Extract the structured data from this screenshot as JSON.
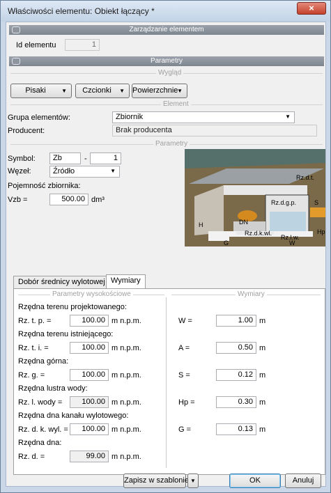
{
  "window": {
    "title": "Właściwości elementu: Obiekt łączący *",
    "close_label": "×"
  },
  "sections": {
    "management": "Zarządzanie elementem",
    "parameters": "Parametry"
  },
  "id": {
    "label": "Id elementu",
    "value": "1"
  },
  "appearance": {
    "group": "Wygląd",
    "pens": "Pisaki",
    "fonts": "Czcionki",
    "surfaces": "Powierzchnie"
  },
  "element": {
    "group": "Element",
    "group_label": "Grupa elementów:",
    "group_value": "Zbiornik",
    "producer_label": "Producent:",
    "producer_value": "Brak producenta"
  },
  "params": {
    "group": "Parametry",
    "symbol_label": "Symbol:",
    "symbol_value": "Zb",
    "symbol_sep": "-",
    "symbol_num": "1",
    "node_label": "Węzeł:",
    "node_value": "Źródło",
    "capacity_label": "Pojemność zbiornika:",
    "vzb_label": "Vzb =",
    "vzb_value": "500.00",
    "vzb_unit": "dm³"
  },
  "diagram": {
    "rzdt": "Rz.d.t.",
    "rzdgp": "Rz.d.g.p.",
    "dn": "DN",
    "rzdkwl": "Rz.d.k.wl.",
    "rzlw": "Rz.l.w.",
    "h": "H",
    "hp": "Hp",
    "g": "G",
    "w": "W",
    "s": "S"
  },
  "tabs": [
    {
      "label": "Dobór średnicy wylotowej"
    },
    {
      "label": "Wymiary"
    }
  ],
  "heights": {
    "group": "Parametry wysokościowe",
    "rows": [
      {
        "title": "Rzędna terenu projektowanego:",
        "label": "Rz. t. p. =",
        "value": "100.00",
        "unit": "m n.p.m."
      },
      {
        "title": "Rzędna terenu istniejącego:",
        "label": "Rz. t. i. =",
        "value": "100.00",
        "unit": "m n.p.m."
      },
      {
        "title": "Rzędna górna:",
        "label": "Rz. g. =",
        "value": "100.00",
        "unit": "m n.p.m."
      },
      {
        "title": "Rzędna lustra wody:",
        "label": "Rz. l. wody =",
        "value": "100.00",
        "unit": "m n.p.m."
      },
      {
        "title": "Rzędna dna kanału wylotowego:",
        "label": "Rz. d. k. wyl. =",
        "value": "100.00",
        "unit": "m n.p.m."
      },
      {
        "title": "Rzędna dna:",
        "label": "Rz. d. =",
        "value": "99.00",
        "unit": "m n.p.m."
      }
    ]
  },
  "dims": {
    "group": "Wymiary",
    "rows": [
      {
        "label": "W =",
        "value": "1.00",
        "unit": "m"
      },
      {
        "label": "A =",
        "value": "0.50",
        "unit": "m"
      },
      {
        "label": "S =",
        "value": "0.12",
        "unit": "m"
      },
      {
        "label": "Hp =",
        "value": "0.30",
        "unit": "m"
      },
      {
        "label": "G =",
        "value": "0.13",
        "unit": "m"
      }
    ]
  },
  "footer": {
    "save_template": "Zapisz w szablonie",
    "ok": "OK",
    "cancel": "Anuluj"
  }
}
